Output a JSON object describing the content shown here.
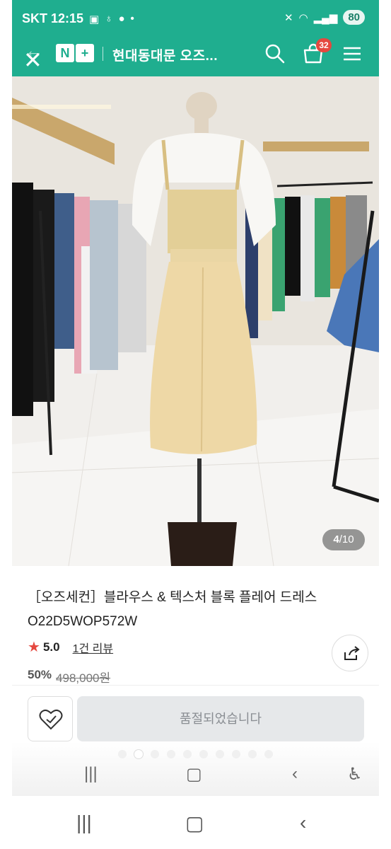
{
  "status_bar": {
    "carrier_time": "SKT 12:15",
    "battery": "80"
  },
  "header": {
    "logo_n": "N",
    "logo_plus": "+",
    "store_title": "현대동대문 오즈...",
    "cart_count": "32"
  },
  "gallery": {
    "current": "4",
    "separator": "/",
    "total": "10"
  },
  "product": {
    "name": "［오즈세컨］블라우스 & 텍스처 블록 플레어 드레스 O22D5WOP572W",
    "rating": "5.0",
    "review_link": "1건 리뷰",
    "discount": "50%",
    "original_price": "498,000원"
  },
  "actions": {
    "sold_out_label": "품절되었습니다"
  },
  "colors": {
    "brand": "#1fae8f",
    "badge": "#e5483f",
    "star": "#e5483f"
  }
}
